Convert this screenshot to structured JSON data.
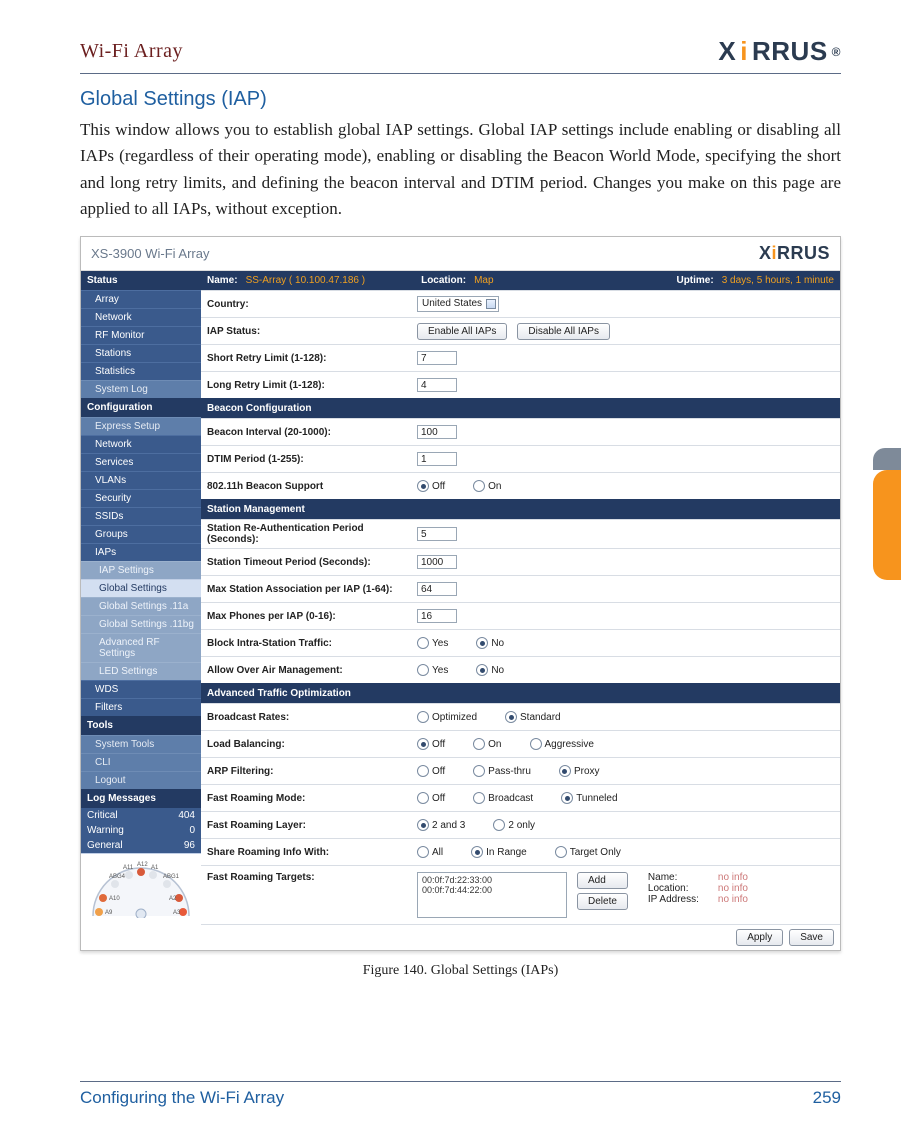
{
  "header": {
    "title": "Wi-Fi Array",
    "brand": "XIRRUS"
  },
  "section": {
    "heading": "Global Settings (IAP)"
  },
  "body_text": "This window allows you to establish global IAP settings. Global IAP settings include enabling or disabling all IAPs (regardless of their operating mode), enabling or disabling the Beacon World Mode, specifying the short and long retry limits, and defining the beacon interval and DTIM period. Changes you make on this page are applied to all IAPs, without exception.",
  "caption": "Figure 140. Global Settings (IAPs)",
  "footer": {
    "left": "Configuring the Wi-Fi Array",
    "page": "259"
  },
  "shot": {
    "product": "XS-3900 Wi-Fi Array",
    "brand": "XIRRUS",
    "hdr": {
      "name_k": "Name:",
      "name_v": "SS-Array   ( 10.100.47.186 )",
      "loc_k": "Location:",
      "loc_v": "Map",
      "up_k": "Uptime:",
      "up_v": "3 days, 5 hours, 1 minute"
    },
    "sidebar": {
      "status": "Status",
      "status_items": [
        "Array",
        "Network",
        "RF Monitor",
        "Stations",
        "Statistics"
      ],
      "status_plain": "System Log",
      "config": "Configuration",
      "config_plain": "Express Setup",
      "config_items": [
        "Network",
        "Services",
        "VLANs",
        "Security",
        "SSIDs",
        "Groups",
        "IAPs"
      ],
      "iap_sub": [
        "IAP Settings",
        "Global Settings",
        "Global Settings .11a",
        "Global Settings .11bg",
        "Advanced RF Settings",
        "LED Settings"
      ],
      "more_items": [
        "WDS",
        "Filters"
      ],
      "tools": "Tools",
      "tools_items": [
        "System Tools",
        "CLI",
        "Logout"
      ],
      "log": "Log Messages",
      "log_rows": [
        {
          "k": "Critical",
          "v": "404"
        },
        {
          "k": "Warning",
          "v": "0"
        },
        {
          "k": "General",
          "v": "96"
        }
      ]
    },
    "rows": {
      "country_l": "Country:",
      "country_v": "United States",
      "iapstatus_l": "IAP Status:",
      "enable": "Enable All IAPs",
      "disable": "Disable All IAPs",
      "short_l": "Short Retry Limit (1-128):",
      "short_v": "7",
      "long_l": "Long Retry Limit (1-128):",
      "long_v": "4",
      "beacon_sec": "Beacon Configuration",
      "bint_l": "Beacon Interval (20-1000):",
      "bint_v": "100",
      "dtim_l": "DTIM Period (1-255):",
      "dtim_v": "1",
      "b11h_l": "802.11h Beacon Support",
      "station_sec": "Station Management",
      "reauth_l": "Station Re-Authentication Period (Seconds):",
      "reauth_v": "5",
      "timeout_l": "Station Timeout Period (Seconds):",
      "timeout_v": "1000",
      "maxsta_l": "Max Station Association per IAP (1-64):",
      "maxsta_v": "64",
      "maxph_l": "Max Phones per IAP (0-16):",
      "maxph_v": "16",
      "block_l": "Block Intra-Station Traffic:",
      "allowair_l": "Allow Over Air Management:",
      "adv_sec": "Advanced Traffic Optimization",
      "bcast_l": "Broadcast Rates:",
      "loadbal_l": "Load Balancing:",
      "arp_l": "ARP Filtering:",
      "frmode_l": "Fast Roaming Mode:",
      "frlayer_l": "Fast Roaming Layer:",
      "share_l": "Share Roaming Info With:",
      "targets_l": "Fast Roaming Targets:",
      "opt_off": "Off",
      "opt_on": "On",
      "opt_yes": "Yes",
      "opt_no": "No",
      "opt_optimized": "Optimized",
      "opt_standard": "Standard",
      "opt_aggr": "Aggressive",
      "opt_pass": "Pass-thru",
      "opt_proxy": "Proxy",
      "opt_bcast": "Broadcast",
      "opt_tun": "Tunneled",
      "opt_23": "2 and 3",
      "opt_2": "2 only",
      "opt_all": "All",
      "opt_range": "In Range",
      "opt_tonly": "Target Only",
      "btn_add": "Add",
      "btn_del": "Delete",
      "targets_list": "00:0f:7d:22:33:00\n00:0f:7d:44:22:00",
      "info_name": "Name:",
      "info_loc": "Location:",
      "info_ip": "IP Address:",
      "info_no": "no info",
      "btn_apply": "Apply",
      "btn_save": "Save"
    }
  }
}
